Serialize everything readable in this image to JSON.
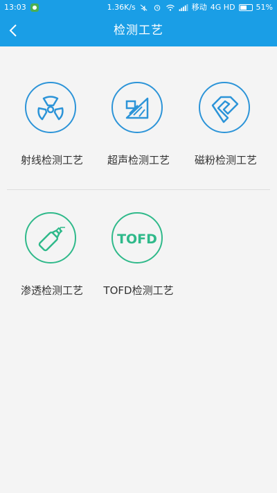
{
  "status_bar": {
    "time": "13:03",
    "network_speed": "1.36K/s",
    "carrier": "移动",
    "network_type": "4G HD",
    "battery": "51%"
  },
  "header": {
    "title": "检测工艺",
    "back_icon": "chevron-left-icon"
  },
  "colors": {
    "primary": "#1a9ee6",
    "icon_blue": "#2c94d8",
    "icon_green": "#2fb98a"
  },
  "tiles": [
    {
      "label": "射线检测工艺",
      "icon": "radiation-icon"
    },
    {
      "label": "超声检测工艺",
      "icon": "ultrasonic-icon"
    },
    {
      "label": "磁粉检测工艺",
      "icon": "magnet-yoke-icon"
    },
    {
      "label": "渗透检测工艺",
      "icon": "spray-can-icon"
    },
    {
      "label": "TOFD检测工艺",
      "icon": "tofd-icon",
      "icon_text": "TOFD"
    }
  ]
}
